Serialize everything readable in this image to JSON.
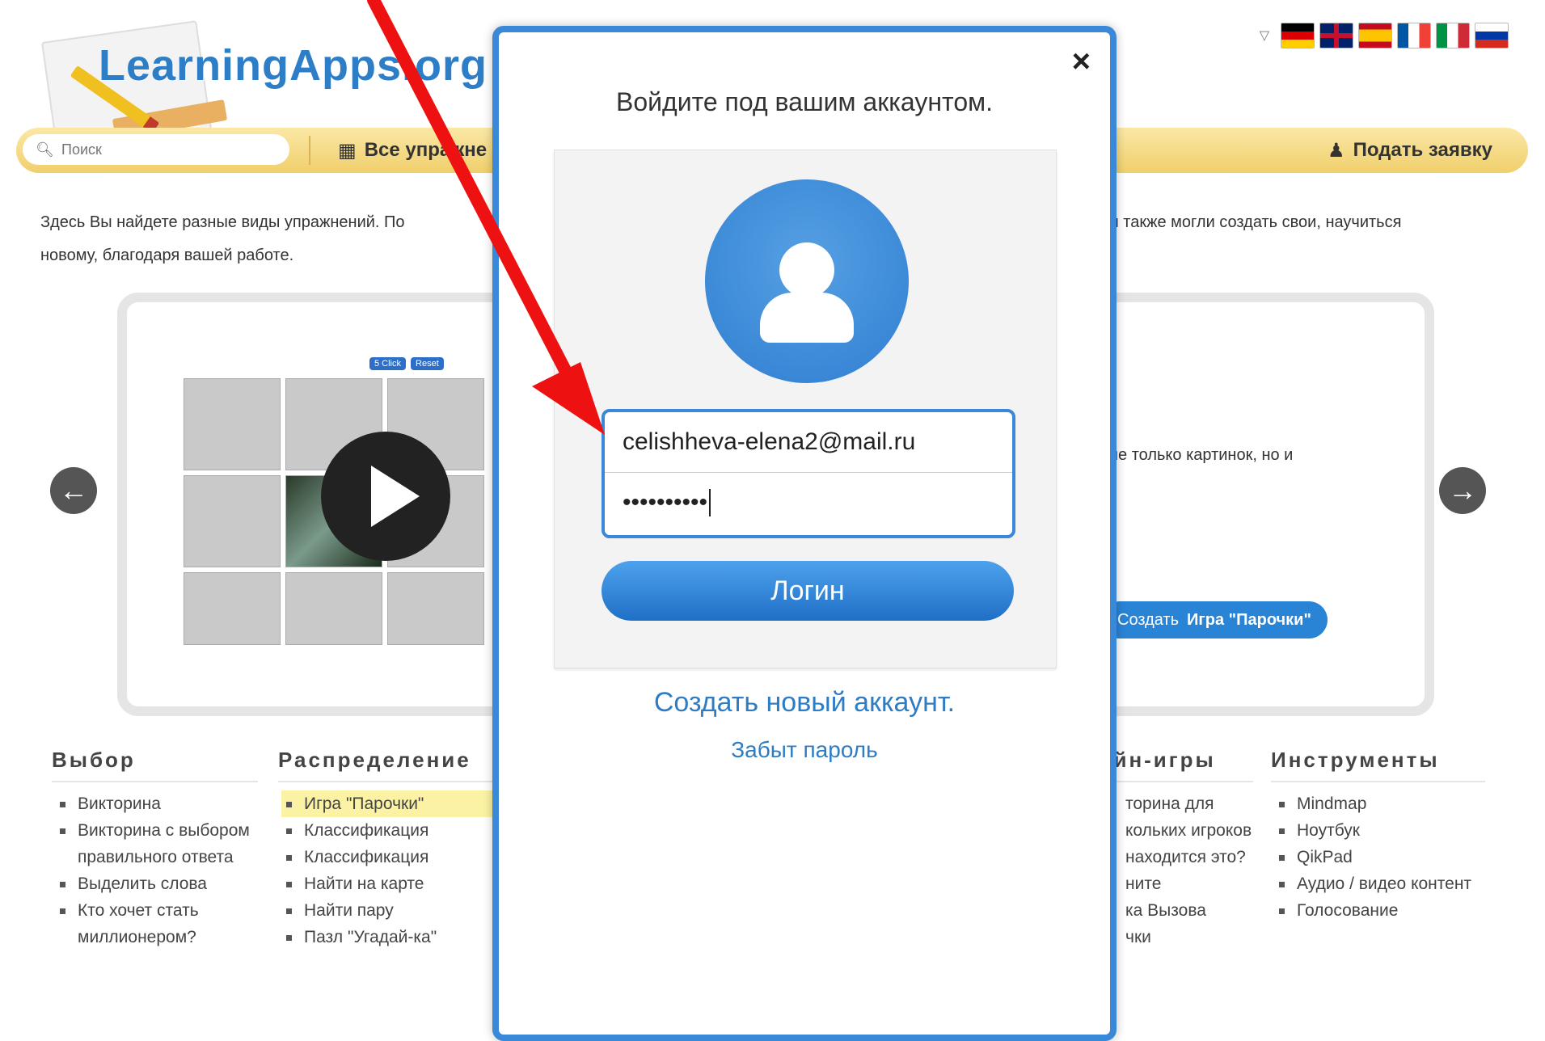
{
  "header": {
    "logo_text": "LearningApps.org",
    "flags": [
      {
        "name": "german-flag",
        "colors": [
          "#000000",
          "#dd0000",
          "#ffce00"
        ]
      },
      {
        "name": "uk-flag",
        "colors": [
          "#012169",
          "#ffffff",
          "#c8102e"
        ]
      },
      {
        "name": "spanish-flag",
        "colors": [
          "#c60b1e",
          "#ffc400",
          "#c60b1e"
        ]
      },
      {
        "name": "french-flag",
        "colors": [
          "#0055a4",
          "#ffffff",
          "#ef4135"
        ]
      },
      {
        "name": "italian-flag",
        "colors": [
          "#009246",
          "#ffffff",
          "#ce2b37"
        ]
      },
      {
        "name": "russian-flag",
        "colors": [
          "#ffffff",
          "#0039a6",
          "#d52b1e"
        ]
      }
    ]
  },
  "nav": {
    "search_placeholder": "Поиск",
    "all_exercises": "Все упражне",
    "signup": "Подать заявку"
  },
  "intro": {
    "line1_left": "Здесь Вы найдете разные виды упражнений. По",
    "line1_right": "м также могли создать свои, научиться",
    "line2": "новому, благодаря вашей работе."
  },
  "slider": {
    "grid_buttons": [
      "5 Click",
      "Reset"
    ],
    "text": "не только картинок, но и",
    "create_prefix": "Создать",
    "create_name": "Игра \"Парочки\""
  },
  "categories": [
    {
      "title": "Выбор",
      "items": [
        "Викторина",
        "Викторина с выбором правильного ответа",
        "Выделить слова",
        "Кто хочет стать миллионером?"
      ]
    },
    {
      "title": "Распределение",
      "items": [
        "Игра \"Парочки\"",
        "Классификация",
        "Классификация",
        "Найти на карте",
        "Найти пару",
        "Пазл \"Угадай-ка\""
      ]
    },
    {
      "title": "айн-игры",
      "items": [
        "торина для кольких игроков",
        "находится это?",
        "ните",
        "ка Вызова",
        "чки"
      ]
    },
    {
      "title": "Инструменты",
      "items": [
        "Mindmap",
        "Ноутбук",
        "QikPad",
        "Аудио / видео контент",
        "Голосование"
      ]
    }
  ],
  "modal": {
    "close": "×",
    "title": "Войдите под вашим аккаунтом.",
    "email": "celishheva-elena2@mail.ru",
    "password_mask": "••••••••••",
    "login_button": "Логин",
    "create_account": "Создать новый аккаунт.",
    "forgot_password": "Забыт пароль"
  },
  "colors": {
    "accent_blue": "#3a88d8",
    "nav_gold": "#f0cf6c",
    "annotation_red": "#ee1111"
  }
}
